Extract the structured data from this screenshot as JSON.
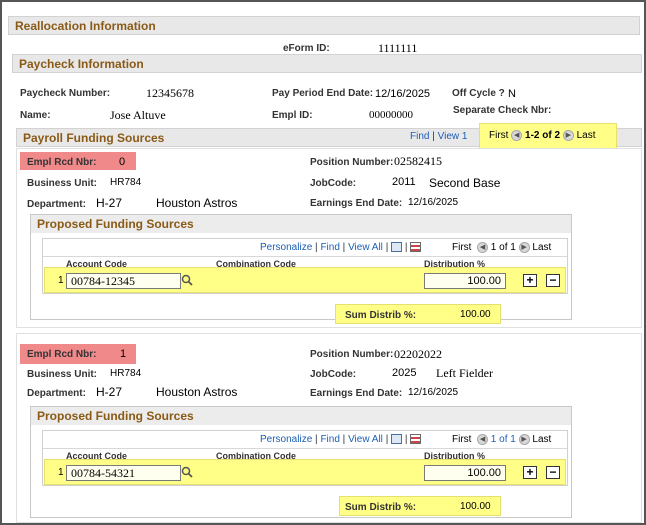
{
  "reallocation": {
    "title": "Reallocation Information",
    "eform_label": "eForm ID:",
    "eform_id": "1111111"
  },
  "paycheck": {
    "title": "Paycheck Information",
    "number_label": "Paycheck Number:",
    "number": "12345678",
    "period_label": "Pay Period End Date:",
    "period": "12/16/2025",
    "offcycle_label": "Off Cycle ?",
    "offcycle": "N",
    "name_label": "Name:",
    "name": "Jose Altuve",
    "emplid_label": "Empl ID:",
    "emplid": "00000000",
    "sepcheck_label": "Separate Check Nbr:"
  },
  "funding": {
    "title": "Payroll Funding Sources",
    "find": "Find",
    "sep": "|",
    "view": "View 1",
    "first": "First",
    "range": "1-2 of 2",
    "last": "Last"
  },
  "records": [
    {
      "rcd_label": "Empl Rcd Nbr:",
      "rcd": "0",
      "pos_label": "Position Number:",
      "pos": "02582415",
      "bu_label": "Business Unit:",
      "bu": "HR784",
      "job_label": "JobCode:",
      "jobcode": "2011",
      "jobdesc": "Second Base",
      "dept_label": "Department:",
      "dept": "H-27",
      "deptdesc": "Houston Astros",
      "earn_label": "Earnings End Date:",
      "earn": "12/16/2025",
      "proposed_title": "Proposed Funding Sources",
      "toolbar": {
        "personalize": "Personalize",
        "find": "Find",
        "viewall": "View All",
        "first": "First",
        "range": "1 of 1",
        "last": "Last"
      },
      "columns": {
        "account": "Account Code",
        "combo": "Combination Code",
        "dist": "Distribution %"
      },
      "row": {
        "num": "1",
        "account": "00784-12345",
        "dist": "100.00"
      },
      "sum_label": "Sum Distrib %:",
      "sum": "100.00"
    },
    {
      "rcd_label": "Empl Rcd Nbr:",
      "rcd": "1",
      "pos_label": "Position Number:",
      "pos": "02202022",
      "bu_label": "Business Unit:",
      "bu": "HR784",
      "job_label": "JobCode:",
      "jobcode": "2025",
      "jobdesc": "Left Fielder",
      "dept_label": "Department:",
      "dept": "H-27",
      "deptdesc": "Houston Astros",
      "earn_label": "Earnings End Date:",
      "earn": "12/16/2025",
      "proposed_title": "Proposed Funding Sources",
      "toolbar": {
        "personalize": "Personalize",
        "find": "Find",
        "viewall": "View All",
        "first": "First",
        "range": "1 of 1",
        "last": "Last"
      },
      "columns": {
        "account": "Account Code",
        "combo": "Combination Code",
        "dist": "Distribution %"
      },
      "row": {
        "num": "1",
        "account": "00784-54321",
        "dist": "100.00"
      },
      "sum_label": "Sum Distrib %:",
      "sum": "100.00"
    }
  ],
  "colors": {
    "header_text": "#8a5a16",
    "highlight_yellow": "#ffff88",
    "highlight_red": "#f08a8a",
    "link": "#1a5fb4"
  }
}
